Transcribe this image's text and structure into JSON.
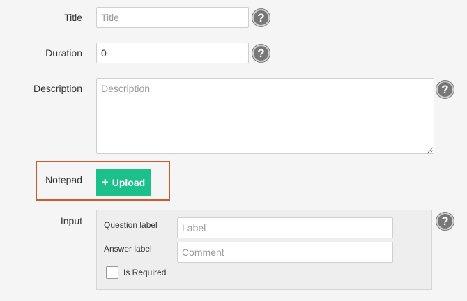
{
  "fields": {
    "title": {
      "label": "Title",
      "placeholder": "Title",
      "value": ""
    },
    "duration": {
      "label": "Duration",
      "value": "0"
    },
    "description": {
      "label": "Description",
      "placeholder": "Description",
      "value": ""
    },
    "notepad": {
      "label": "Notepad",
      "upload_label": "Upload",
      "upload_icon": "plus-icon"
    },
    "input": {
      "label": "Input",
      "question_label": "Question label",
      "question_placeholder": "Label",
      "answer_label": "Answer label",
      "answer_placeholder": "Comment",
      "required_label": "Is Required",
      "required_checked": false
    }
  },
  "help_glyph": "?",
  "colors": {
    "upload_button": "#1bc08a",
    "highlight_border": "#cf5b2c",
    "help_icon": "#777777"
  }
}
